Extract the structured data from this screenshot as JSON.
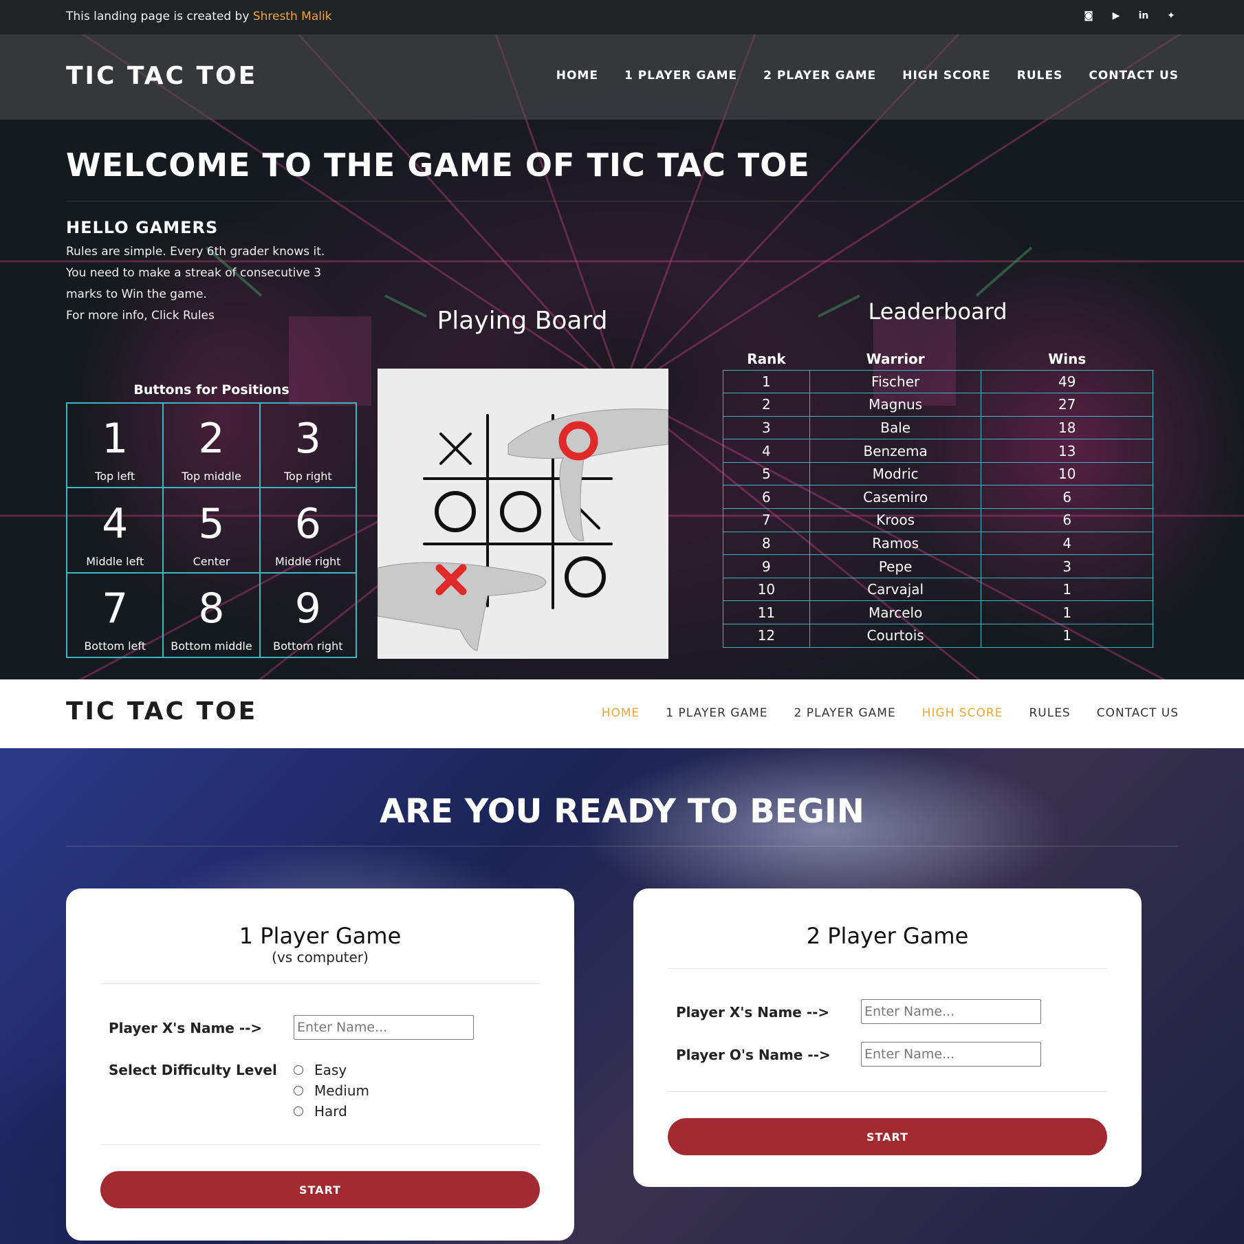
{
  "topbar": {
    "credit_prefix": "This landing page is created by",
    "credit_author": "Shresth Malik",
    "socials": [
      {
        "icon": "instagram-icon",
        "glyph": "◙"
      },
      {
        "icon": "youtube-icon",
        "glyph": "▶"
      },
      {
        "icon": "linkedin-icon",
        "glyph": "in"
      },
      {
        "icon": "twitter-icon",
        "glyph": "✦"
      }
    ]
  },
  "brand": "TIC TAC TOE",
  "nav": [
    "HOME",
    "1 PLAYER GAME",
    "2 PLAYER GAME",
    "HIGH SCORE",
    "RULES",
    "CONTACT US"
  ],
  "hero": {
    "title": "WELCOME TO THE GAME OF TIC TAC TOE",
    "intro_heading": "HELLO GAMERS",
    "intro_lines": [
      "Rules are simple. Every 6th grader knows it.",
      "You need to make a streak of consecutive 3",
      "marks to Win the game.",
      "For more info, Click Rules"
    ],
    "positions_title": "Buttons for Positions",
    "positions": [
      {
        "num": "1",
        "label": "Top left"
      },
      {
        "num": "2",
        "label": "Top middle"
      },
      {
        "num": "3",
        "label": "Top right"
      },
      {
        "num": "4",
        "label": "Middle left"
      },
      {
        "num": "5",
        "label": "Center"
      },
      {
        "num": "6",
        "label": "Middle right"
      },
      {
        "num": "7",
        "label": "Bottom left"
      },
      {
        "num": "8",
        "label": "Bottom middle"
      },
      {
        "num": "9",
        "label": "Bottom right"
      }
    ],
    "board_title": "Playing Board",
    "leaderboard_title": "Leaderboard",
    "leaderboard_headers": [
      "Rank",
      "Warrior",
      "Wins"
    ],
    "leaderboard": [
      [
        "1",
        "Fischer",
        "49"
      ],
      [
        "2",
        "Magnus",
        "27"
      ],
      [
        "3",
        "Bale",
        "18"
      ],
      [
        "4",
        "Benzema",
        "13"
      ],
      [
        "5",
        "Modric",
        "10"
      ],
      [
        "6",
        "Casemiro",
        "6"
      ],
      [
        "7",
        "Kroos",
        "6"
      ],
      [
        "8",
        "Ramos",
        "4"
      ],
      [
        "9",
        "Pepe",
        "3"
      ],
      [
        "10",
        "Carvajal",
        "1"
      ],
      [
        "11",
        "Marcelo",
        "1"
      ],
      [
        "12",
        "Courtois",
        "1"
      ]
    ]
  },
  "nav2_active": [
    "HOME",
    "HIGH SCORE"
  ],
  "games": {
    "title": "ARE YOU READY TO BEGIN",
    "one_player": {
      "title": "1 Player Game",
      "subtitle": "(vs computer)",
      "name_label": "Player X's Name -->",
      "name_placeholder": "Enter Name...",
      "difficulty_label": "Select Difficulty Level",
      "difficulties": [
        "Easy",
        "Medium",
        "Hard"
      ],
      "start": "START"
    },
    "two_player": {
      "title": "2 Player Game",
      "x_label": "Player X's Name -->",
      "o_label": "Player O's Name -->",
      "placeholder": "Enter Name...",
      "start": "START"
    }
  },
  "colors": {
    "accent": "#f0a430",
    "grid": "#3fb6c4",
    "start_button": "#a22a30"
  }
}
